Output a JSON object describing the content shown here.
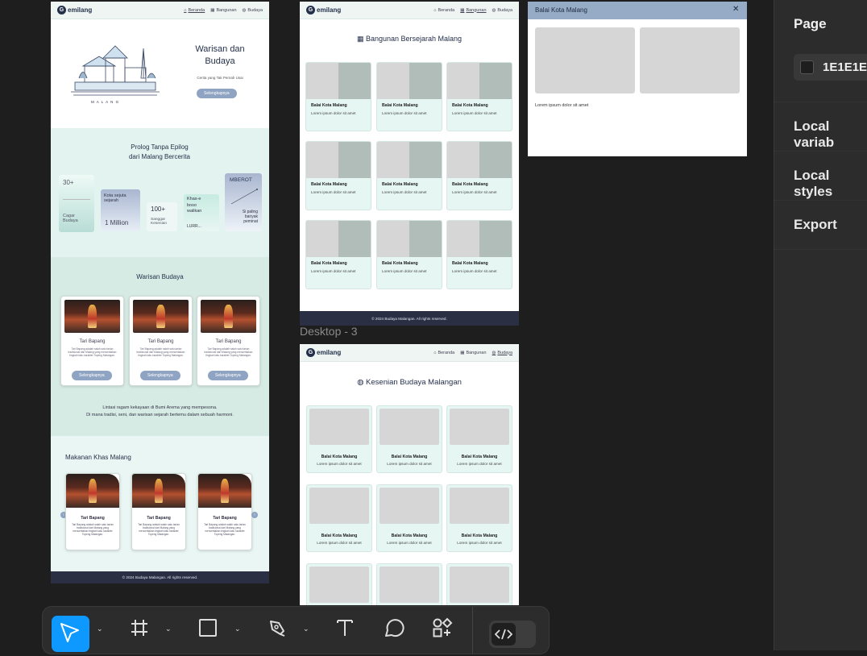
{
  "desk1": {
    "logo": "emilang",
    "logo_g": "G",
    "nav": [
      "Beranda",
      "Bangunan",
      "Budaya"
    ],
    "hero_title": "Warisan dan Budaya",
    "hero_sub": "Cerita yang Tak Pernah Usai",
    "hero_btn": "Selengkapnya",
    "malang": "M A L A N G",
    "prolog_title": "Prolog Tanpa Epilog\ndari Malang Bercerita",
    "stats": {
      "s1_num": "30+",
      "s1_label": "Cagar Budaya",
      "s2_label": "Kota sejuta sejarah",
      "s2_num": "1 Million",
      "s3_num": "100+",
      "s3_label": "Sanggar Kesenian",
      "s4_label": "Khas-e boso walikan",
      "s4_sub": "LURR...",
      "s5_title": "MBEROT",
      "s5_label": "Si paling banyak peminat"
    },
    "warisan_title": "Warisan Budaya",
    "warisan_cards": [
      {
        "title": "Tari Bapang",
        "desc": "Tari Bapang adalah salah satu tarian tradisional dari Malang yang menceritakan tingkah laku karakter Topeng Malangan.",
        "btn": "Selengkapnya"
      },
      {
        "title": "Tari Bapang",
        "desc": "Tari Bapang adalah salah satu tarian tradisional dari Malang yang menceritakan tingkah laku karakter Topeng Malangan.",
        "btn": "Selengkapnya"
      },
      {
        "title": "Tari Bapang",
        "desc": "Tari Bapang adalah salah satu tarian tradisional dari Malang yang menceritakan tingkah laku karakter Topeng Malangan.",
        "btn": "Selengkapnya"
      }
    ],
    "tagline": "Lintasi ragam kekayaan di Bumi Arema yang mempesona.\nDi mana tradisi, seni, dan warisan sejarah bertemu dalam sebuah harmoni.",
    "makanan_title": "Makanan Khas Malang",
    "makanan_cards": [
      {
        "title": "Tari Bapang",
        "desc": "Tari Bapang adalah salah satu tarian tradisional dari Malang yang menceritakan tingkah laku karakter Topeng Malangan."
      },
      {
        "title": "Tari Bapang",
        "desc": "Tari Bapang adalah salah satu tarian tradisional dari Malang yang menceritakan tingkah laku karakter Topeng Malangan."
      },
      {
        "title": "Tari Bapang",
        "desc": "Tari Bapang adalah salah satu tarian tradisional dari Malang yang menceritakan tingkah laku karakter Topeng Malangan."
      }
    ],
    "footer": "© 2024 Budaya Malangan. All rights reserved."
  },
  "desk2": {
    "logo": "emilang",
    "logo_g": "G",
    "nav": [
      "Beranda",
      "Bangunan",
      "Budaya"
    ],
    "title": "Bangunan Bersejarah Malang",
    "cards": [
      {
        "title": "Balai Kota Malang",
        "desc": "Lorem ipsum dolor sit amet"
      },
      {
        "title": "Balai Kota Malang",
        "desc": "Lorem ipsum dolor sit amet"
      },
      {
        "title": "Balai Kota Malang",
        "desc": "Lorem ipsum dolor sit amet"
      },
      {
        "title": "Balai Kota Malang",
        "desc": "Lorem ipsum dolor sit amet"
      },
      {
        "title": "Balai Kota Malang",
        "desc": "Lorem ipsum dolor sit amet"
      },
      {
        "title": "Balai Kota Malang",
        "desc": "Lorem ipsum dolor sit amet"
      },
      {
        "title": "Balai Kota Malang",
        "desc": "Lorem ipsum dolor sit amet"
      },
      {
        "title": "Balai Kota Malang",
        "desc": "Lorem ipsum dolor sit amet"
      },
      {
        "title": "Balai Kota Malang",
        "desc": "Lorem ipsum dolor sit amet"
      }
    ],
    "footer": "© 2024 Budaya Malangan. All rights reserved."
  },
  "desk3": {
    "frame_label": "Desktop - 3",
    "logo": "emilang",
    "logo_g": "G",
    "nav": [
      "Beranda",
      "Bangunan",
      "Budaya"
    ],
    "title": "Kesenian Budaya Malangan",
    "cards": [
      {
        "title": "Balai Kota Malang",
        "desc": "Lorem ipsum dolor sit amet"
      },
      {
        "title": "Balai Kota Malang",
        "desc": "Lorem ipsum dolor sit amet"
      },
      {
        "title": "Balai Kota Malang",
        "desc": "Lorem ipsum dolor sit amet"
      },
      {
        "title": "Balai Kota Malang",
        "desc": "Lorem ipsum dolor sit amet"
      },
      {
        "title": "Balai Kota Malang",
        "desc": "Lorem ipsum dolor sit amet"
      },
      {
        "title": "Balai Kota Malang",
        "desc": "Lorem ipsum dolor sit amet"
      }
    ]
  },
  "modal": {
    "title": "Balai Kota Malang",
    "close": "✕",
    "desc": "Lorem ipsum dolor sit amet"
  },
  "panel": {
    "page_heading": "Page",
    "color_value": "1E1E1E",
    "local_variables": "Local variab",
    "local_styles": "Local styles",
    "export": "Export"
  },
  "colors": {
    "canvas": "#1e1e1e",
    "accent": "#0d99ff",
    "navy": "#24304a",
    "mint": "#e6f7f3"
  },
  "toolbar": {
    "icons": [
      "move-tool",
      "frame-tool",
      "rectangle-tool",
      "pen-tool",
      "text-tool",
      "comment-tool",
      "components-tool",
      "dev-mode-toggle"
    ]
  }
}
